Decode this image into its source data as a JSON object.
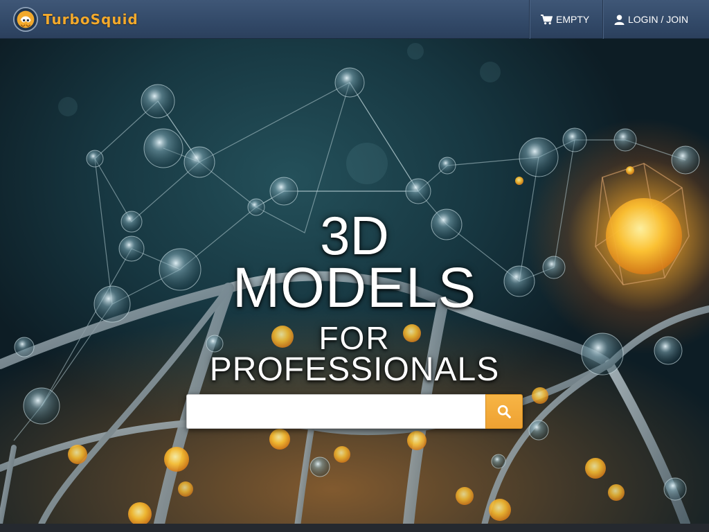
{
  "header": {
    "brand_name": "TurboSquid",
    "logo_icon": "squid-logo-icon",
    "cart": {
      "icon": "cart-icon",
      "label": "EMPTY"
    },
    "account": {
      "icon": "user-icon",
      "label": "LOGIN / JOIN"
    }
  },
  "hero": {
    "line1": "3D",
    "line2": "MODELS",
    "line3": "FOR",
    "line4": "PROFESSIONALS",
    "background": "molecular-network-render"
  },
  "search": {
    "value": "",
    "placeholder": "",
    "button_icon": "search-icon"
  },
  "colors": {
    "header_bg": "#344b6a",
    "brand_orange": "#f2a92c",
    "search_button": "#f0a535",
    "text_white": "#ffffff"
  }
}
